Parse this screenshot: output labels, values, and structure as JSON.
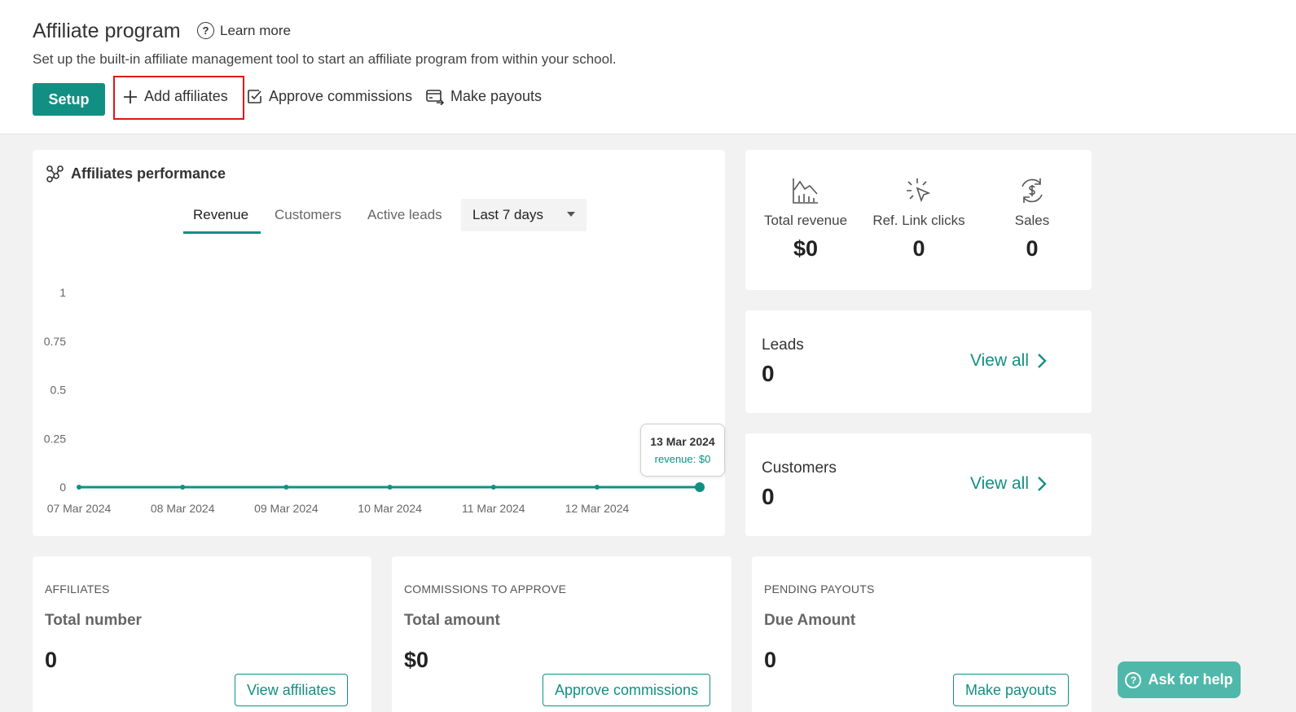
{
  "header": {
    "title": "Affiliate program",
    "learn_more": "Learn more",
    "subtitle": "Set up the built-in affiliate management tool to start an affiliate program from within your school.",
    "actions": {
      "setup": "Setup",
      "add_affiliates": "Add affiliates",
      "approve_commissions": "Approve commissions",
      "make_payouts": "Make payouts"
    }
  },
  "performance": {
    "title": "Affiliates performance",
    "tabs": [
      "Revenue",
      "Customers",
      "Active leads"
    ],
    "active_tab": "Revenue",
    "period": "Last 7 days",
    "tooltip": {
      "date": "13 Mar 2024",
      "value": "revenue: $0"
    }
  },
  "chart_data": {
    "type": "line",
    "x": [
      "07 Mar 2024",
      "08 Mar 2024",
      "09 Mar 2024",
      "10 Mar 2024",
      "11 Mar 2024",
      "12 Mar 2024",
      "13 Mar 2024"
    ],
    "x_tick_labels": [
      "07 Mar 2024",
      "08 Mar 2024",
      "09 Mar 2024",
      "10 Mar 2024",
      "11 Mar 2024",
      "12 Mar 2024"
    ],
    "series": [
      {
        "values": [
          0,
          0,
          0,
          0,
          0,
          0,
          0
        ]
      }
    ],
    "y_ticks": [
      "1",
      "0.75",
      "0.5",
      "0.25",
      "0"
    ],
    "ylim": [
      0,
      1
    ],
    "grid": false,
    "line_color": "#128f83"
  },
  "summary": {
    "stats": [
      {
        "label": "Total revenue",
        "value": "$0",
        "icon": "chart-icon"
      },
      {
        "label": "Ref. Link clicks",
        "value": "0",
        "icon": "click-icon"
      },
      {
        "label": "Sales",
        "value": "0",
        "icon": "dollar-cycle-icon"
      }
    ]
  },
  "leads": {
    "label": "Leads",
    "value": "0",
    "view_all": "View all"
  },
  "customers": {
    "label": "Customers",
    "value": "0",
    "view_all": "View all"
  },
  "bottom": {
    "affiliates": {
      "heading": "AFFILIATES",
      "sub": "Total number",
      "value": "0",
      "button": "View affiliates"
    },
    "commissions": {
      "heading": "COMMISSIONS TO APPROVE",
      "sub": "Total amount",
      "value": "$0",
      "button": "Approve commissions"
    },
    "payouts": {
      "heading": "PENDING PAYOUTS",
      "sub": "Due Amount",
      "value": "0",
      "button": "Make payouts"
    }
  },
  "help": {
    "label": "Ask for help"
  },
  "colors": {
    "accent": "#128f83",
    "highlight_box": "#e01616",
    "help_bg": "#4fb8aa"
  }
}
